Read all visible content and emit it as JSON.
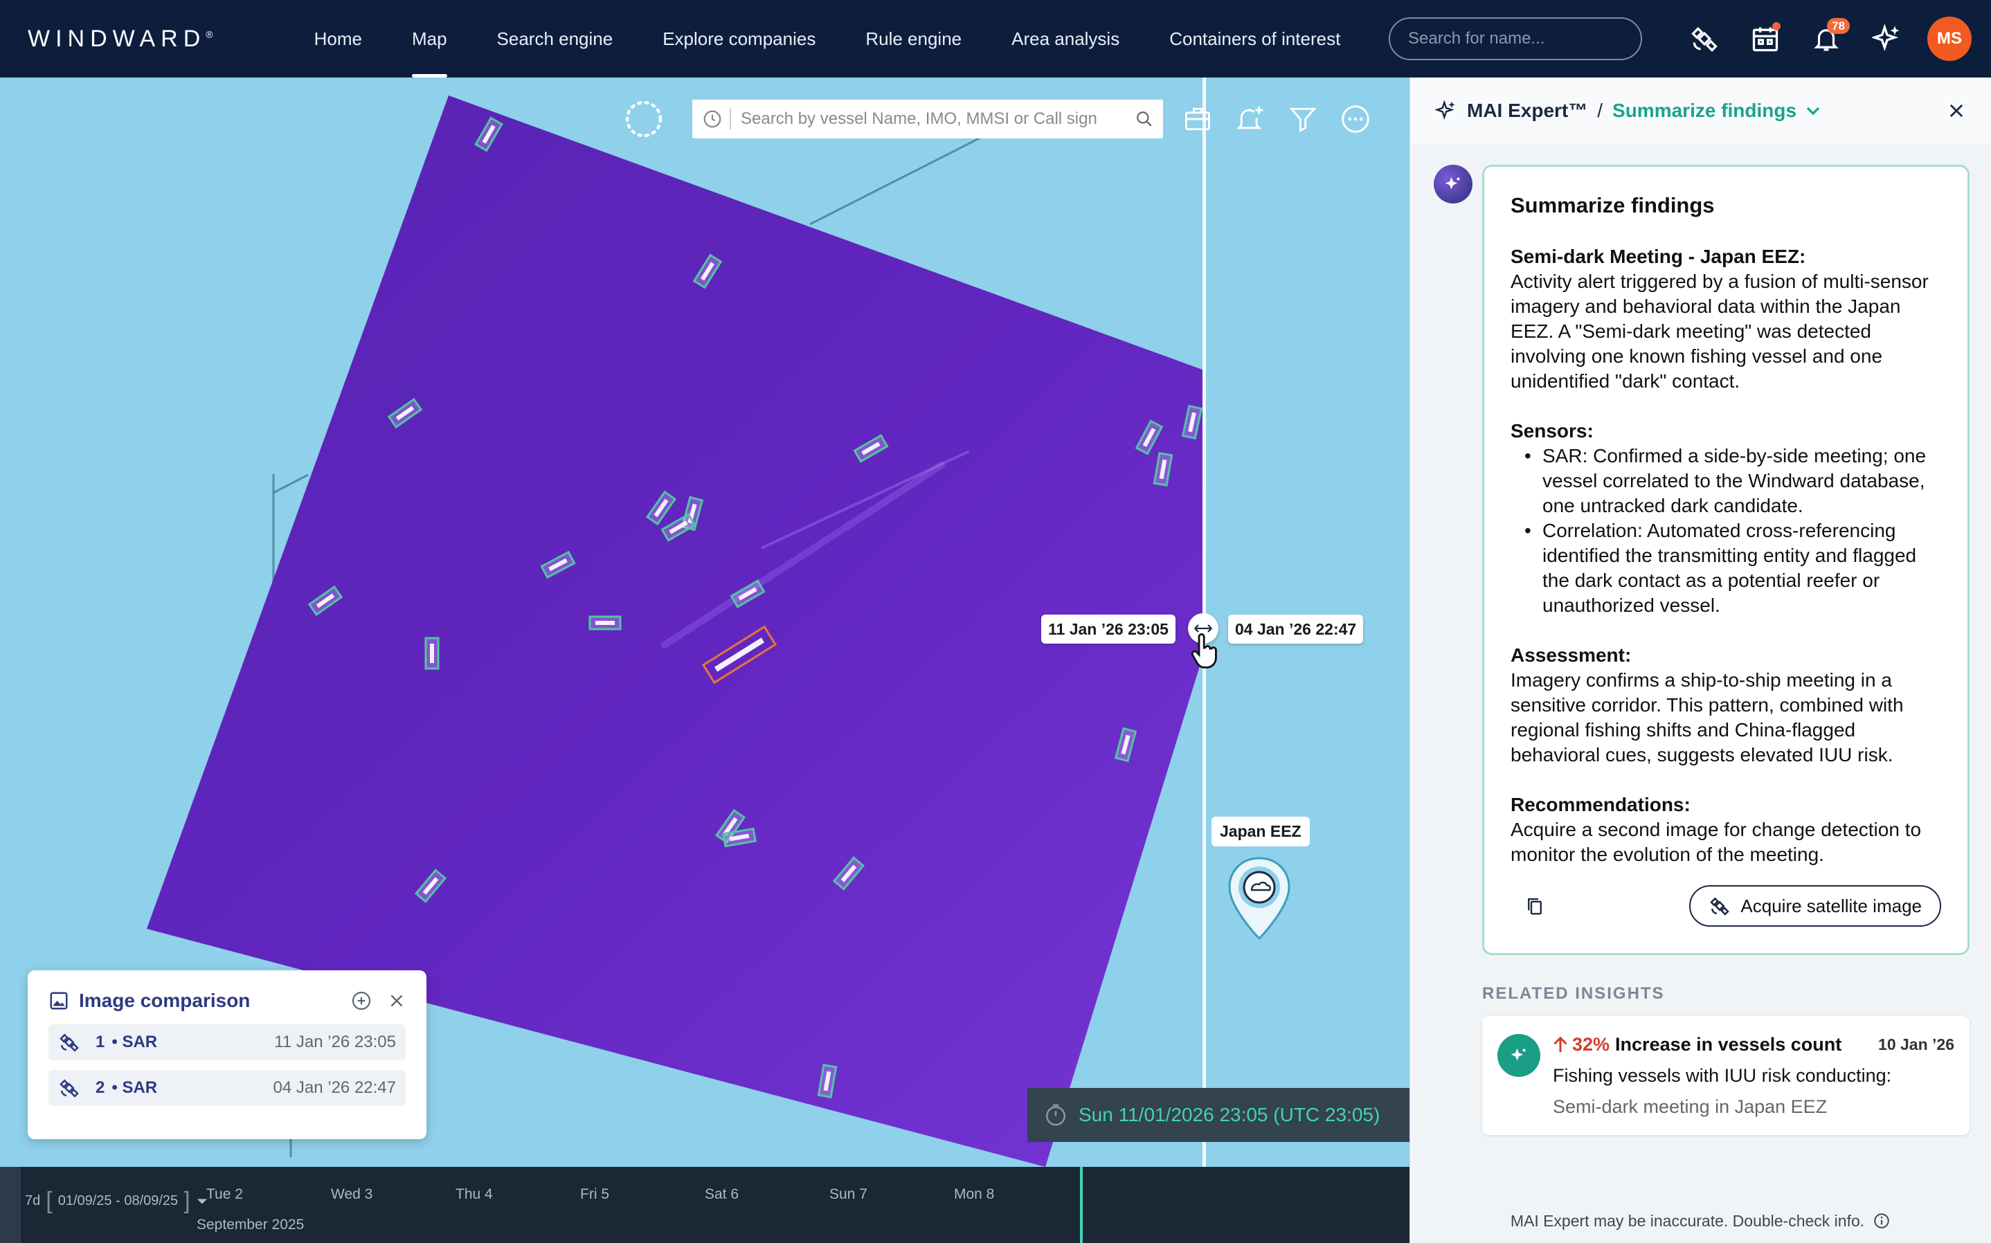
{
  "app": {
    "logo": "WINDWARD",
    "logo_mark": "®"
  },
  "nav": {
    "items": [
      {
        "label": "Home",
        "active": false
      },
      {
        "label": "Map",
        "active": true
      },
      {
        "label": "Search engine",
        "active": false
      },
      {
        "label": "Explore companies",
        "active": false
      },
      {
        "label": "Rule engine",
        "active": false
      },
      {
        "label": "Area analysis",
        "active": false
      },
      {
        "label": "Containers of interest",
        "active": false
      }
    ],
    "search_placeholder": "Search for name...",
    "notification_count": "78",
    "avatar_initials": "MS"
  },
  "map": {
    "vessel_search_placeholder": "Search by vessel Name, IMO, MMSI or Call sign",
    "compare_left_date": "11 Jan ’26  23:05",
    "compare_right_date": "04 Jan ’26  22:47",
    "area_label": "Japan EEZ",
    "timestamp": "Sun 11/01/2026 23:05 (UTC 23:05)",
    "sat_color": "#7b2fe0",
    "detection_color": "#4fc6a0",
    "highlight_color": "#e8743a"
  },
  "image_comparison": {
    "title": "Image comparison",
    "rows": [
      {
        "num": "1",
        "type": "SAR",
        "date": "11 Jan ’26  23:05"
      },
      {
        "num": "2",
        "type": "SAR",
        "date": "04 Jan ’26  22:47"
      }
    ]
  },
  "timeline": {
    "range_label": "7d",
    "range_dates": "01/09/25 - 08/09/25",
    "days": [
      "Tue 2",
      "Wed 3",
      "Thu 4",
      "Fri 5",
      "Sat 6",
      "Sun 7",
      "Mon 8"
    ],
    "month": "September 2025"
  },
  "panel": {
    "expert": "MAI Expert™",
    "topic": "Summarize findings",
    "summary": {
      "title": "Summarize findings",
      "s1_heading": "Semi-dark Meeting - Japan EEZ:",
      "s1_body": "Activity alert triggered by a fusion of multi-sensor imagery and behavioral data within the Japan EEZ. A \"Semi-dark meeting\" was detected involving one known fishing vessel and one unidentified \"dark\" contact.",
      "s2_heading": "Sensors:",
      "s2_bullets": [
        "SAR: Confirmed a side-by-side meeting; one vessel correlated to the Windward database, one untracked dark candidate.",
        "Correlation: Automated cross-referencing identified the transmitting entity and flagged the dark contact as a potential reefer or unauthorized vessel."
      ],
      "s3_heading": "Assessment:",
      "s3_body": "Imagery confirms a ship-to-ship meeting in a sensitive corridor. This pattern, combined with regional fishing shifts and China-flagged behavioral cues, suggests elevated IUU risk.",
      "s4_heading": "Recommendations:",
      "s4_body": "Acquire a second image for change detection to monitor the evolution of the meeting.",
      "acquire_label": "Acquire satellite image"
    },
    "related_label": "RELATED INSIGHTS",
    "insight": {
      "pct": "32%",
      "title": "Increase in vessels count",
      "date": "10 Jan ’26",
      "line2": "Fishing vessels with IUU risk conducting:",
      "line3": "Semi-dark meeting in Japan EEZ"
    },
    "disclaimer": "MAI Expert may be inaccurate. Double-check info."
  }
}
